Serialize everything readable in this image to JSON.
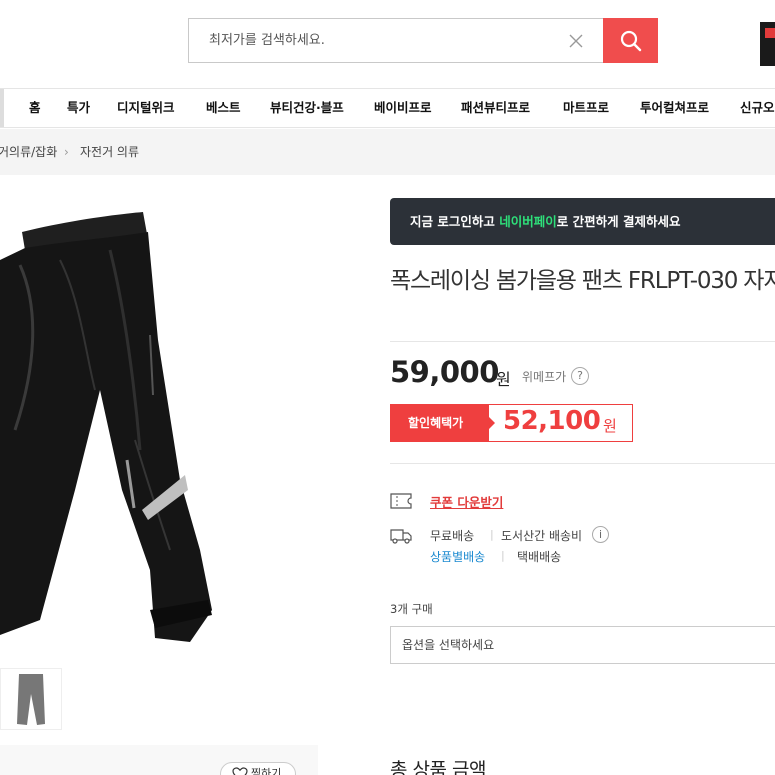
{
  "header": {
    "search_placeholder": "최저가를 검색하세요.",
    "brand_color": "#f04d4d"
  },
  "nav": {
    "items": [
      {
        "label": "홈"
      },
      {
        "label": "특가"
      },
      {
        "label": "디지털위크"
      },
      {
        "label": "베스트"
      },
      {
        "label": "뷰티건강·블프"
      },
      {
        "label": "베이비프로"
      },
      {
        "label": "패션뷰티프로"
      },
      {
        "label": "마트프로"
      },
      {
        "label": "투어컬쳐프로"
      },
      {
        "label": "신규오"
      }
    ]
  },
  "breadcrumb": {
    "items": [
      "거의류/잡화",
      "자전거 의류"
    ]
  },
  "product": {
    "banner_prefix": "지금 로그인하고 ",
    "banner_highlight": "네이버페이",
    "banner_suffix": "로 간편하게 결제하세요",
    "title": "폭스레이싱 봄가을용 팬츠 FRLPT-030 자지",
    "price_original": "59,000",
    "price_unit": "원",
    "price_source": "위메프가",
    "help_symbol": "?",
    "discount_label": "할인혜택가",
    "discount_price": "52,100",
    "discount_unit": "원",
    "coupon_label": "쿠폰 다운받기",
    "shipping_free": "무료배송",
    "shipping_extra": "도서산간 배송비",
    "info_symbol": "i",
    "shipping_per_item": "상품별배송",
    "shipping_courier": "택배배송",
    "qty_label": "3개 구매",
    "option_placeholder": "옵션을 선택하세요",
    "wish_label": "찜하기",
    "total_label": "총 상품 금액"
  },
  "colors": {
    "discount": "#ef3f3f",
    "naverpay_highlight": "#2ee07a",
    "banner_bg": "#2c3138",
    "link_blue": "#1b8ad0"
  }
}
